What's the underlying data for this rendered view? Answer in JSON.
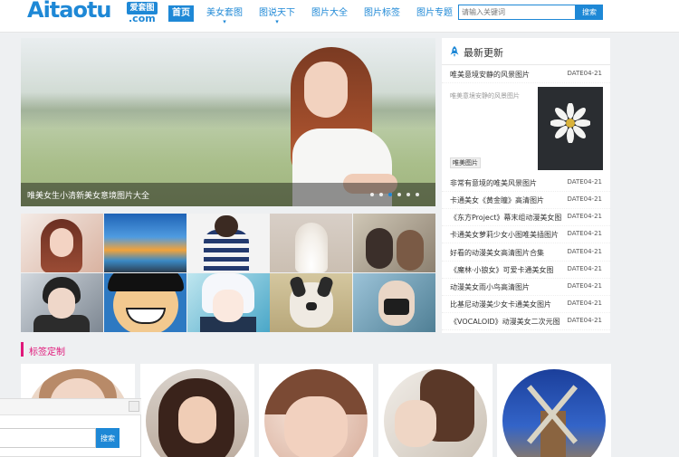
{
  "logo": {
    "text": "Aitaotu",
    "badge": "爱套图",
    "domain": ".com"
  },
  "nav": [
    {
      "label": "首页",
      "active": true
    },
    {
      "label": "美女套图"
    },
    {
      "label": "图说天下"
    },
    {
      "label": "图片大全"
    },
    {
      "label": "图片标签"
    },
    {
      "label": "图片专题"
    }
  ],
  "search": {
    "placeholder": "请输入关键词",
    "button": "搜索"
  },
  "slider": {
    "caption": "唯美女生小清新美女意境图片大全",
    "slide_count": 6,
    "active_index": 2
  },
  "latest": {
    "title": "最新更新",
    "top_item": {
      "title": "唯美意境安静的风景图片",
      "date": "DATE04-21"
    },
    "feature": {
      "desc": "唯美意境安静的风景图片",
      "tag": "唯美图片"
    },
    "items": [
      {
        "title": "非常有意境的唯美风景图片",
        "date": "DATE04-21"
      },
      {
        "title": "卡通美女《黄金瞳》高清图片",
        "date": "DATE04-21"
      },
      {
        "title": "《东方Project》幕末组动漫美女图",
        "date": "DATE04-21"
      },
      {
        "title": "卡通美女萝莉少女小图唯美插图片",
        "date": "DATE04-21"
      },
      {
        "title": "好看的动漫美女高清图片合集",
        "date": "DATE04-21"
      },
      {
        "title": "《魔林·小狼女》可爱卡通美女图",
        "date": "DATE04-21"
      },
      {
        "title": "动漫美女雨小鸟高清图片",
        "date": "DATE04-21"
      },
      {
        "title": "比基尼动漫美少女卡通美女图片",
        "date": "DATE04-21"
      },
      {
        "title": "《VOCALOID》动漫美女二次元图",
        "date": "DATE04-21"
      }
    ]
  },
  "tags_section": {
    "title": "标签定制"
  },
  "float_search": {
    "button": "搜索"
  },
  "colors": {
    "accent": "#1e88d6",
    "section": "#e0187a"
  }
}
